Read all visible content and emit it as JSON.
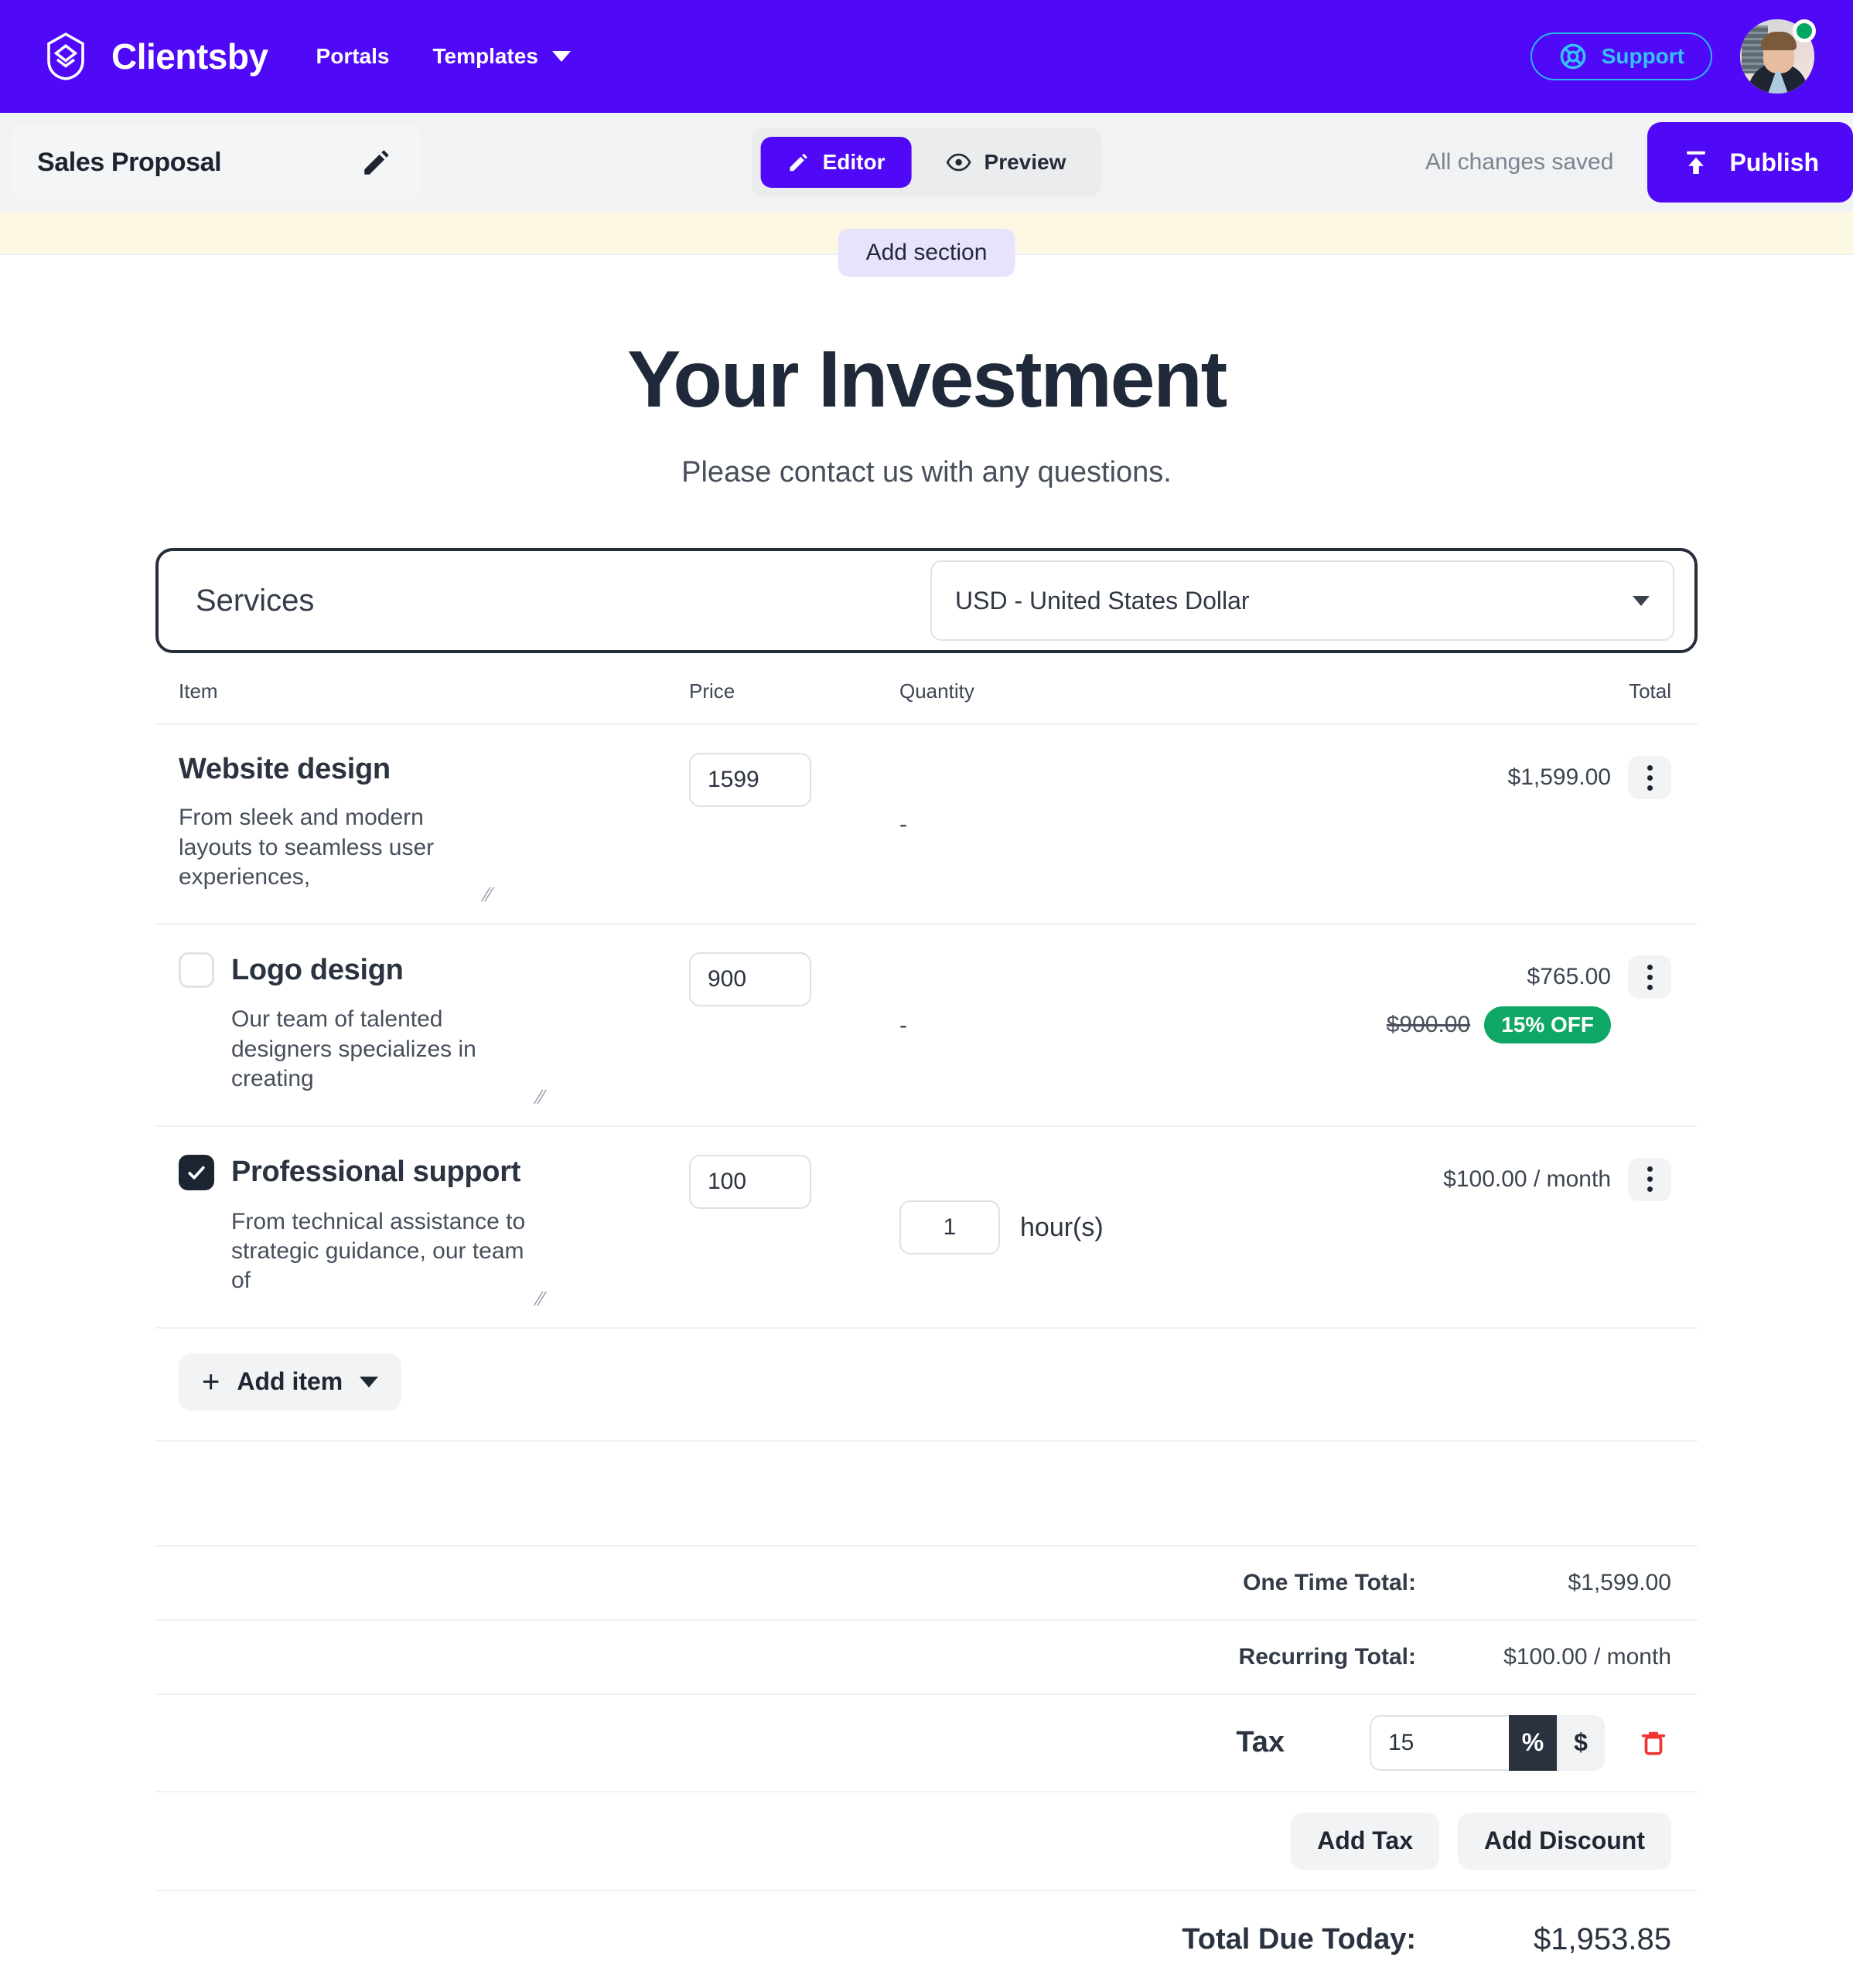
{
  "topnav": {
    "brand": "Clientsby",
    "logo_icon": "clientsby-diamond-logo-icon",
    "links": [
      {
        "label": "Portals",
        "has_caret": false
      },
      {
        "label": "Templates",
        "has_caret": true
      }
    ],
    "support_label": "Support",
    "support_icon": "lifebuoy-icon",
    "avatar_icon": "user-avatar",
    "status_icon": "online-status-dot"
  },
  "subbar": {
    "doc_title": "Sales Proposal",
    "edit_icon": "pencil-icon",
    "editor_label": "Editor",
    "editor_icon": "pencil-icon",
    "preview_label": "Preview",
    "preview_icon": "eye-icon",
    "saved_status": "All changes saved",
    "publish_label": "Publish",
    "publish_icon": "upload-icon"
  },
  "band": {
    "add_section_label": "Add section"
  },
  "hero": {
    "title": "Your Investment",
    "subtitle": "Please contact us with any questions."
  },
  "services": {
    "label": "Services",
    "currency_value": "USD - United States Dollar",
    "currency_caret_icon": "chevron-down-icon"
  },
  "table": {
    "headers": {
      "item": "Item",
      "price": "Price",
      "quantity": "Quantity",
      "total": "Total"
    },
    "rows": [
      {
        "name": "Website design",
        "description": "From sleek and modern layouts to seamless user experiences,",
        "price": "1599",
        "quantity_dash": "-",
        "quantity": null,
        "unit": null,
        "total": "$1,599.00",
        "has_checkbox": false,
        "checked": false,
        "old_price": null,
        "discount_badge": null,
        "menu_icon": "kebab-menu-icon"
      },
      {
        "name": "Logo design",
        "description": "Our team of talented designers specializes in creating",
        "price": "900",
        "quantity_dash": "-",
        "quantity": null,
        "unit": null,
        "total": "$765.00",
        "has_checkbox": true,
        "checked": false,
        "old_price": "$900.00",
        "discount_badge": "15% OFF",
        "menu_icon": "kebab-menu-icon"
      },
      {
        "name": "Professional support",
        "description": "From technical assistance to strategic guidance, our team of",
        "price": "100",
        "quantity_dash": null,
        "quantity": "1",
        "unit": "hour(s)",
        "total": "$100.00 / month",
        "has_checkbox": true,
        "checked": true,
        "old_price": null,
        "discount_badge": null,
        "menu_icon": "kebab-menu-icon"
      }
    ],
    "add_item_label": "Add item",
    "add_item_icon": "plus-icon",
    "add_item_caret_icon": "chevron-down-icon"
  },
  "summary": {
    "one_time_label": "One Time Total:",
    "one_time_value": "$1,599.00",
    "recurring_label": "Recurring Total:",
    "recurring_value": "$100.00 / month",
    "tax_label": "Tax",
    "tax_value": "15",
    "tax_unit_percent": "%",
    "tax_unit_currency": "$",
    "tax_delete_icon": "trash-icon",
    "add_tax_label": "Add Tax",
    "add_discount_label": "Add Discount",
    "total_due_label": "Total Due Today:",
    "total_due_value": "$1,953.85"
  },
  "colors": {
    "brand_purple": "#4f09f7",
    "support_cyan": "#35c2fb",
    "discount_green": "#0ea765",
    "band_yellow": "#fdf8e3",
    "pill_lavender": "#e8e3fd",
    "trash_red": "#f0342f",
    "dark": "#2a3240"
  }
}
